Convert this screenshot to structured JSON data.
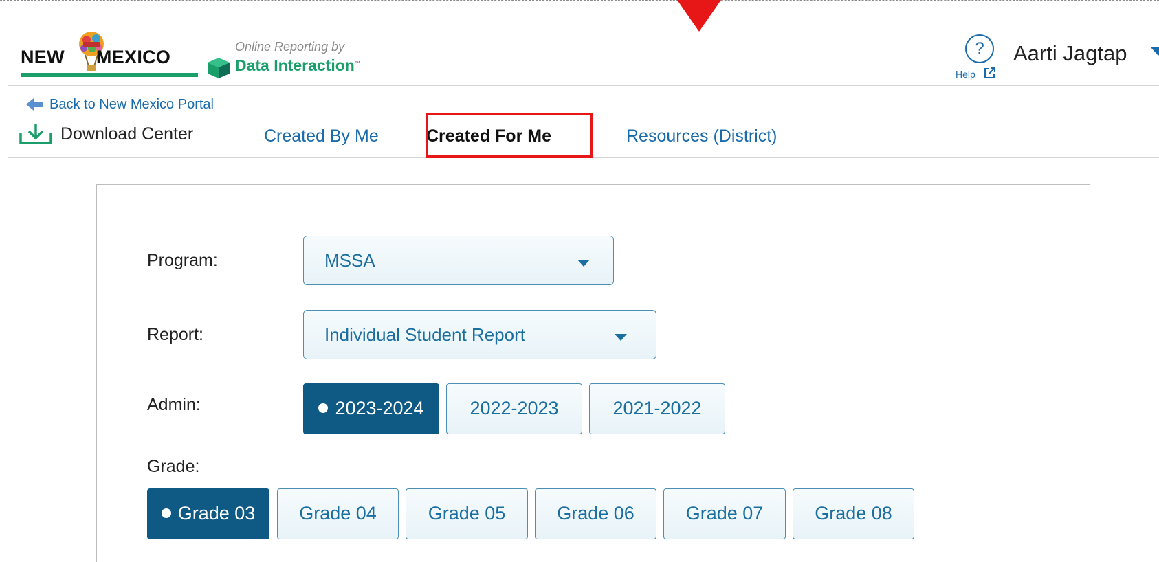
{
  "header": {
    "logo_state": "NEW MEXICO",
    "logo_word1": "NEW",
    "logo_word2": "MEXICO",
    "vendor_tagline": "Online Reporting by",
    "vendor_name": "Data Interaction",
    "vendor_tm": "™",
    "help_label": "Help",
    "help_glyph": "?",
    "user_name": "Aarti Jagtap"
  },
  "nav": {
    "back_link": "Back to New Mexico Portal",
    "tabs": [
      {
        "label": "Download Center",
        "icon": "download-icon"
      },
      {
        "label": "Created By Me"
      },
      {
        "label": "Created For Me",
        "active": true
      },
      {
        "label": "Resources (District)"
      }
    ]
  },
  "form": {
    "program_label": "Program:",
    "program_value": "MSSA",
    "report_label": "Report:",
    "report_value": "Individual Student Report",
    "admin_label": "Admin:",
    "admin_options": [
      "2023-2024",
      "2022-2023",
      "2021-2022"
    ],
    "admin_selected": "2023-2024",
    "grade_label": "Grade:",
    "grade_options": [
      "Grade 03",
      "Grade 04",
      "Grade 05",
      "Grade 06",
      "Grade 07",
      "Grade 08"
    ],
    "grade_selected": "Grade 03"
  },
  "colors": {
    "accent": "#1a6bab",
    "active_pill": "#0f5a85",
    "highlight": "#e81717",
    "brand_green": "#1a9f6b"
  }
}
